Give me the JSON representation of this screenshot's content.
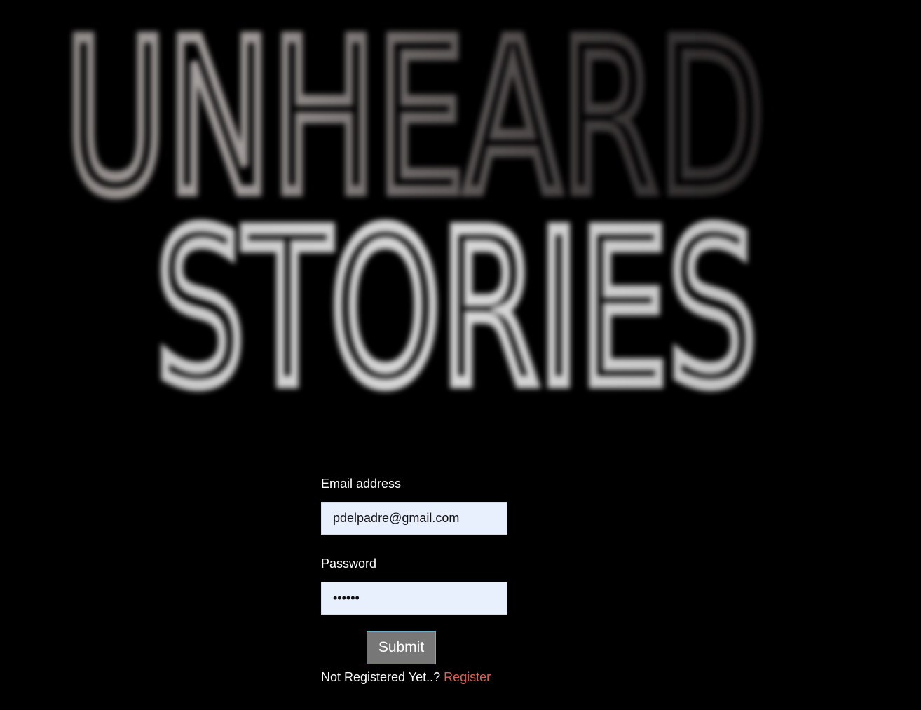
{
  "logo": {
    "line1": "UNHEARD",
    "line2": "STORIES"
  },
  "login_form": {
    "email_label": "Email address",
    "email_value": "pdelpadre@gmail.com",
    "password_label": "Password",
    "password_value": "••••••",
    "submit_label": "Submit",
    "register_prompt": "Not Registered Yet..?",
    "register_link": "Register"
  },
  "colors": {
    "background": "#000000",
    "input_background": "#e8f0fe",
    "button_background": "#777777",
    "link": "#e0614e"
  }
}
